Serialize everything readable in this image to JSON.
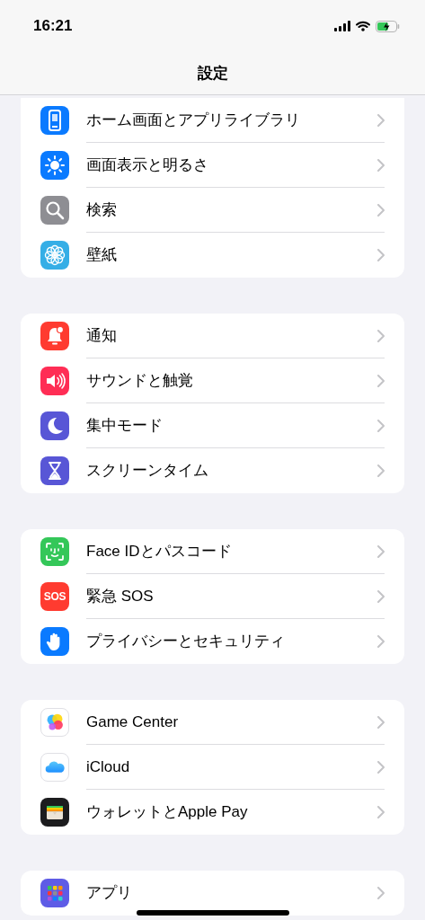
{
  "status_bar": {
    "time": "16:21"
  },
  "nav": {
    "title": "設定"
  },
  "groups": [
    {
      "items": [
        {
          "label": "ホーム画面とアプリライブラリ",
          "kind": "phone",
          "color": "#0a7aff"
        },
        {
          "label": "画面表示と明るさ",
          "kind": "sun",
          "color": "#0a7aff"
        },
        {
          "label": "検索",
          "kind": "search",
          "color": "#8e8e93"
        },
        {
          "label": "壁紙",
          "kind": "flower",
          "color": "#35aee6"
        }
      ]
    },
    {
      "items": [
        {
          "label": "通知",
          "kind": "bell",
          "color": "#ff3b30"
        },
        {
          "label": "サウンドと触覚",
          "kind": "speaker",
          "color": "#ff2d55"
        },
        {
          "label": "集中モード",
          "kind": "moon",
          "color": "#5856d6"
        },
        {
          "label": "スクリーンタイム",
          "kind": "hourglass",
          "color": "#5856d6"
        }
      ]
    },
    {
      "items": [
        {
          "label": "Face IDとパスコード",
          "kind": "face",
          "color": "#34c759"
        },
        {
          "label": "緊急 SOS",
          "kind": "sos",
          "color": "#ff3b30",
          "icon_text": "SOS"
        },
        {
          "label": "プライバシーとセキュリティ",
          "kind": "hand",
          "color": "#0a7aff"
        }
      ]
    },
    {
      "items": [
        {
          "label": "Game Center",
          "kind": "bubbles",
          "color": "#ffffff"
        },
        {
          "label": "iCloud",
          "kind": "cloud",
          "color": "#ffffff"
        },
        {
          "label": "ウォレットとApple Pay",
          "kind": "wallet",
          "color": "#1c1c1e"
        }
      ]
    },
    {
      "items": [
        {
          "label": "アプリ",
          "kind": "grid",
          "color": "#5e5ce6"
        }
      ]
    }
  ]
}
